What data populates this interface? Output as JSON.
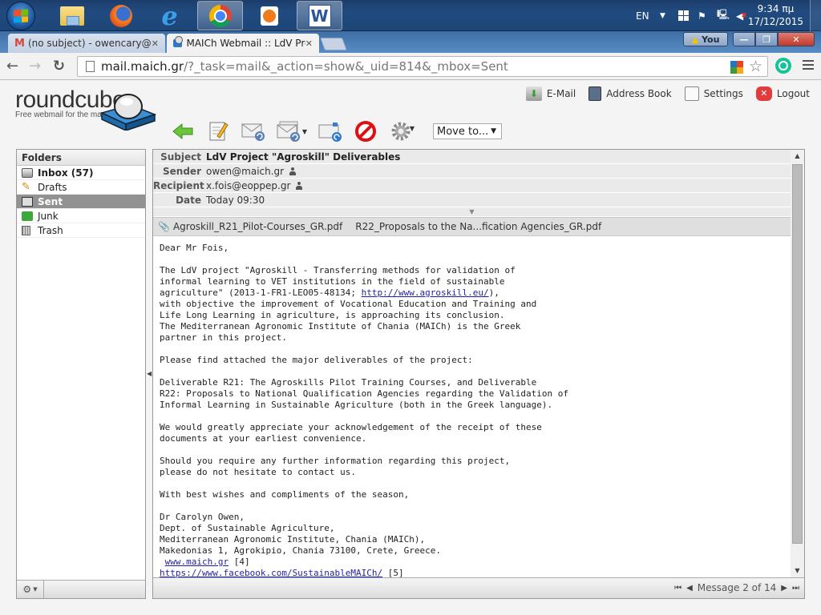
{
  "taskbar": {
    "apps": [
      {
        "name": "file-explorer",
        "active": false
      },
      {
        "name": "firefox",
        "active": false
      },
      {
        "name": "internet-explorer",
        "active": false
      },
      {
        "name": "chrome",
        "active": true
      },
      {
        "name": "media-player",
        "active": false
      },
      {
        "name": "word",
        "active": true
      }
    ],
    "word_letter": "W",
    "ie_letter": "e",
    "language": "EN",
    "time": "9:34 πμ",
    "date": "17/12/2015"
  },
  "browser": {
    "tabs": [
      {
        "title": "(no subject) - owencary@g",
        "active": false,
        "icon": "gmail-icon"
      },
      {
        "title": "MAICh Webmail :: LdV Pro",
        "active": true,
        "icon": "roundcube-icon"
      }
    ],
    "tab_close_glyph": "✕",
    "profile_button": "You",
    "url_host": "mail.maich.gr",
    "url_path": "/?_task=mail&_action=show&_uid=814&_mbox=Sent"
  },
  "app": {
    "logo_text": "roundcube",
    "logo_tagline": "Free webmail for the masses",
    "nav": [
      {
        "label": "E-Mail",
        "icon": "email-icon"
      },
      {
        "label": "Address Book",
        "icon": "address-book-icon"
      },
      {
        "label": "Settings",
        "icon": "settings-icon"
      },
      {
        "label": "Logout",
        "icon": "logout-icon"
      }
    ],
    "toolbar": {
      "move_to": "Move to..."
    }
  },
  "folders": {
    "title": "Folders",
    "items": [
      {
        "label": "Inbox (57)",
        "icon": "inbox-icon",
        "bold": true,
        "selected": false
      },
      {
        "label": "Drafts",
        "icon": "drafts-icon",
        "bold": false,
        "selected": false
      },
      {
        "label": "Sent",
        "icon": "sent-icon",
        "bold": false,
        "selected": true
      },
      {
        "label": "Junk",
        "icon": "junk-icon",
        "bold": false,
        "selected": false
      },
      {
        "label": "Trash",
        "icon": "trash-icon",
        "bold": false,
        "selected": false
      }
    ]
  },
  "message": {
    "headers": {
      "subject_label": "Subject",
      "subject": "LdV Project \"Agroskill\" Deliverables",
      "sender_label": "Sender",
      "sender": "owen@maich.gr",
      "recipient_label": "Recipient",
      "recipient": "x.fois@eoppep.gr",
      "date_label": "Date",
      "date": "Today 09:30"
    },
    "attachments": [
      "Agroskill_R21_Pilot-Courses_GR.pdf",
      "R22_Proposals to the Na...fication Agencies_GR.pdf"
    ],
    "body": {
      "p1": "Dear Mr Fois,",
      "p2a": "The LdV project \"Agroskill - Transferring methods for validation of\ninformal learning to VET institutions in the field of sustainable\nagriculture\" (2013-1-FR1-LEO05-48134; ",
      "p2_link": "http://www.agroskill.eu/",
      "p2b": "),\nwith objective the improvement of Vocational Education and Training and\nLife Long Learning in agriculture, is approaching its conclusion.\nThe Mediterranean Agronomic Institute of Chania (MAICh) is the Greek\npartner in this project.",
      "p3": "Please find attached the major deliverables of the project:",
      "p4": "Deliverable R21: The Agroskills Pilot Training Courses, and Deliverable\nR22: Proposals to National Qualification Agencies regarding the Validation of\nInformal Learning in Sustainable Agriculture (both in the Greek language).",
      "p5": "We would greatly appreciate your acknowledgement of the receipt of these\ndocuments at your earliest convenience.",
      "p6": "Should you require any further information regarding this project,\nplease do not hesitate to contact us.",
      "p7": "With best wishes and compliments of the season,",
      "sig": "Dr Carolyn Owen,\nDept. of Sustainable Agriculture,\nMediterranean Agronomic Institute, Chania (MAICh),\nMakedonias 1, Agrokipio, Chania 73100, Crete, Greece.",
      "link1": "www.maich.gr",
      "link1_ref": " [4]",
      "link2": "https://www.facebook.com/SustainableMAICh/",
      "link2_ref": " [5]"
    },
    "pager": "Message 2 of 14"
  }
}
